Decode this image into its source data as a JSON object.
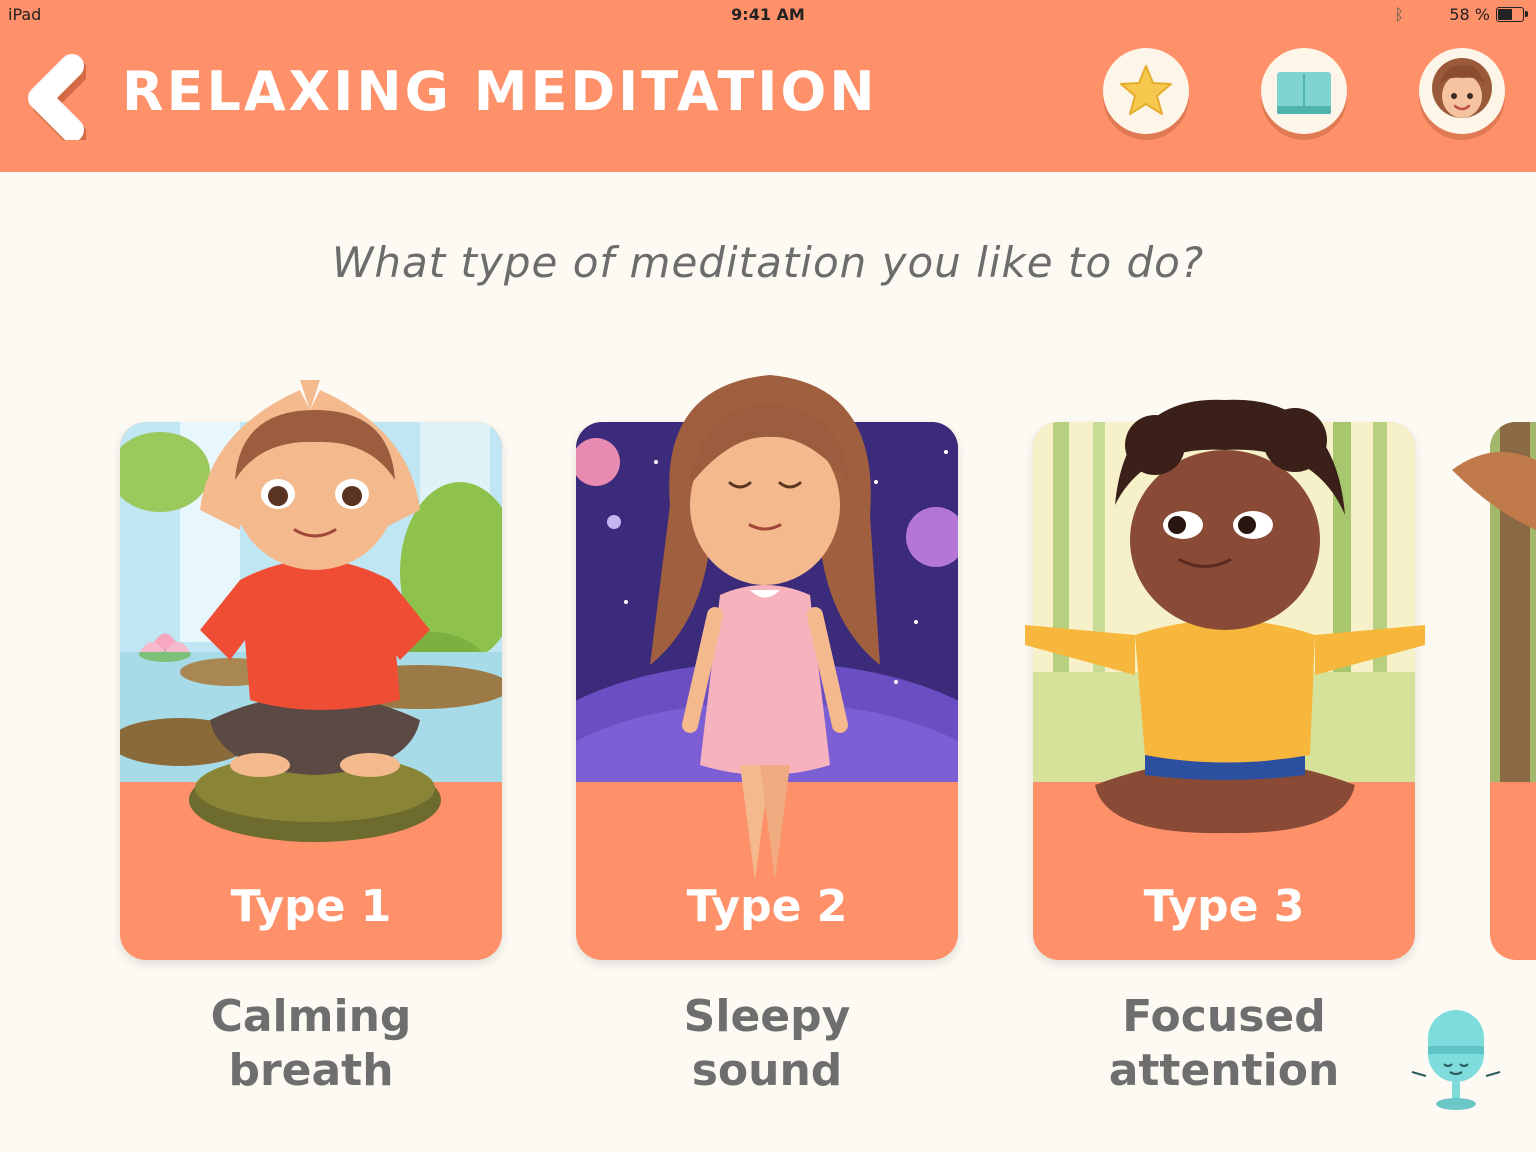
{
  "status_bar": {
    "device": "iPad",
    "time": "9:41 AM",
    "battery": "58 %"
  },
  "header": {
    "title": "RELAXING MEDITATION",
    "icons": [
      "back-arrow-icon",
      "star-icon",
      "book-icon",
      "avatar"
    ]
  },
  "question": "What type of meditation you like to do?",
  "cards": [
    {
      "label": "Type 1",
      "description_line1": "Calming",
      "description_line2": "breath"
    },
    {
      "label": "Type 2",
      "description_line1": "Sleepy",
      "description_line2": "sound"
    },
    {
      "label": "Type 3",
      "description_line1": "Focused",
      "description_line2": "attention"
    }
  ],
  "colors": {
    "header": "#ff916a",
    "background": "#fdfaf4",
    "card": "#ff916a",
    "question_text": "#6c6c6c",
    "mic": "#7fdcdc"
  }
}
